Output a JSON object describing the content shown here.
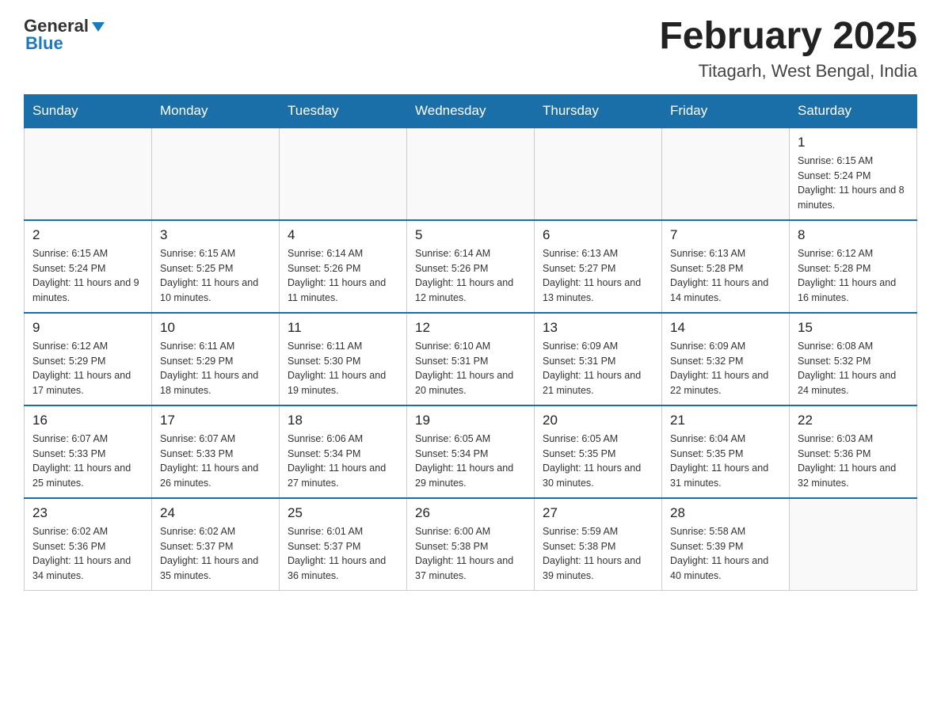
{
  "header": {
    "logo_general": "General",
    "logo_blue": "Blue",
    "title": "February 2025",
    "subtitle": "Titagarh, West Bengal, India"
  },
  "days_of_week": [
    "Sunday",
    "Monday",
    "Tuesday",
    "Wednesday",
    "Thursday",
    "Friday",
    "Saturday"
  ],
  "weeks": [
    [
      {
        "day": "",
        "info": ""
      },
      {
        "day": "",
        "info": ""
      },
      {
        "day": "",
        "info": ""
      },
      {
        "day": "",
        "info": ""
      },
      {
        "day": "",
        "info": ""
      },
      {
        "day": "",
        "info": ""
      },
      {
        "day": "1",
        "info": "Sunrise: 6:15 AM\nSunset: 5:24 PM\nDaylight: 11 hours and 8 minutes."
      }
    ],
    [
      {
        "day": "2",
        "info": "Sunrise: 6:15 AM\nSunset: 5:24 PM\nDaylight: 11 hours and 9 minutes."
      },
      {
        "day": "3",
        "info": "Sunrise: 6:15 AM\nSunset: 5:25 PM\nDaylight: 11 hours and 10 minutes."
      },
      {
        "day": "4",
        "info": "Sunrise: 6:14 AM\nSunset: 5:26 PM\nDaylight: 11 hours and 11 minutes."
      },
      {
        "day": "5",
        "info": "Sunrise: 6:14 AM\nSunset: 5:26 PM\nDaylight: 11 hours and 12 minutes."
      },
      {
        "day": "6",
        "info": "Sunrise: 6:13 AM\nSunset: 5:27 PM\nDaylight: 11 hours and 13 minutes."
      },
      {
        "day": "7",
        "info": "Sunrise: 6:13 AM\nSunset: 5:28 PM\nDaylight: 11 hours and 14 minutes."
      },
      {
        "day": "8",
        "info": "Sunrise: 6:12 AM\nSunset: 5:28 PM\nDaylight: 11 hours and 16 minutes."
      }
    ],
    [
      {
        "day": "9",
        "info": "Sunrise: 6:12 AM\nSunset: 5:29 PM\nDaylight: 11 hours and 17 minutes."
      },
      {
        "day": "10",
        "info": "Sunrise: 6:11 AM\nSunset: 5:29 PM\nDaylight: 11 hours and 18 minutes."
      },
      {
        "day": "11",
        "info": "Sunrise: 6:11 AM\nSunset: 5:30 PM\nDaylight: 11 hours and 19 minutes."
      },
      {
        "day": "12",
        "info": "Sunrise: 6:10 AM\nSunset: 5:31 PM\nDaylight: 11 hours and 20 minutes."
      },
      {
        "day": "13",
        "info": "Sunrise: 6:09 AM\nSunset: 5:31 PM\nDaylight: 11 hours and 21 minutes."
      },
      {
        "day": "14",
        "info": "Sunrise: 6:09 AM\nSunset: 5:32 PM\nDaylight: 11 hours and 22 minutes."
      },
      {
        "day": "15",
        "info": "Sunrise: 6:08 AM\nSunset: 5:32 PM\nDaylight: 11 hours and 24 minutes."
      }
    ],
    [
      {
        "day": "16",
        "info": "Sunrise: 6:07 AM\nSunset: 5:33 PM\nDaylight: 11 hours and 25 minutes."
      },
      {
        "day": "17",
        "info": "Sunrise: 6:07 AM\nSunset: 5:33 PM\nDaylight: 11 hours and 26 minutes."
      },
      {
        "day": "18",
        "info": "Sunrise: 6:06 AM\nSunset: 5:34 PM\nDaylight: 11 hours and 27 minutes."
      },
      {
        "day": "19",
        "info": "Sunrise: 6:05 AM\nSunset: 5:34 PM\nDaylight: 11 hours and 29 minutes."
      },
      {
        "day": "20",
        "info": "Sunrise: 6:05 AM\nSunset: 5:35 PM\nDaylight: 11 hours and 30 minutes."
      },
      {
        "day": "21",
        "info": "Sunrise: 6:04 AM\nSunset: 5:35 PM\nDaylight: 11 hours and 31 minutes."
      },
      {
        "day": "22",
        "info": "Sunrise: 6:03 AM\nSunset: 5:36 PM\nDaylight: 11 hours and 32 minutes."
      }
    ],
    [
      {
        "day": "23",
        "info": "Sunrise: 6:02 AM\nSunset: 5:36 PM\nDaylight: 11 hours and 34 minutes."
      },
      {
        "day": "24",
        "info": "Sunrise: 6:02 AM\nSunset: 5:37 PM\nDaylight: 11 hours and 35 minutes."
      },
      {
        "day": "25",
        "info": "Sunrise: 6:01 AM\nSunset: 5:37 PM\nDaylight: 11 hours and 36 minutes."
      },
      {
        "day": "26",
        "info": "Sunrise: 6:00 AM\nSunset: 5:38 PM\nDaylight: 11 hours and 37 minutes."
      },
      {
        "day": "27",
        "info": "Sunrise: 5:59 AM\nSunset: 5:38 PM\nDaylight: 11 hours and 39 minutes."
      },
      {
        "day": "28",
        "info": "Sunrise: 5:58 AM\nSunset: 5:39 PM\nDaylight: 11 hours and 40 minutes."
      },
      {
        "day": "",
        "info": ""
      }
    ]
  ]
}
